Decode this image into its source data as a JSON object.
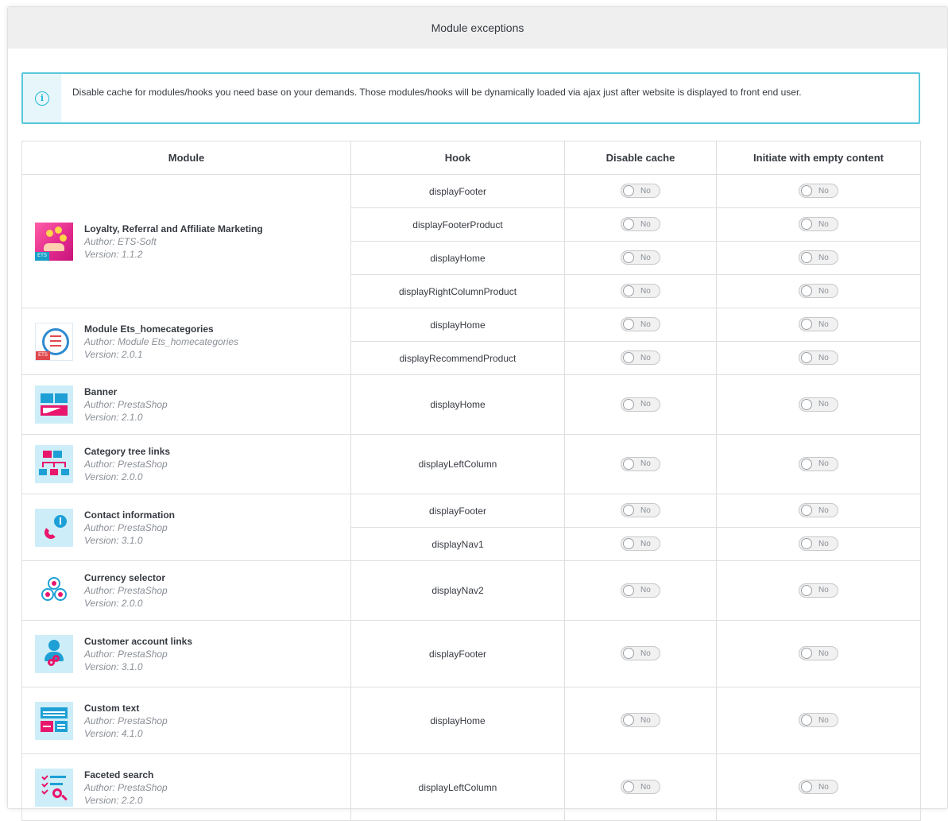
{
  "panel": {
    "title": "Module exceptions"
  },
  "alert": {
    "icon": "info-circle-icon",
    "text": "Disable cache for modules/hooks you need base on your demands. Those modules/hooks will be dynamically loaded via ajax just after website is displayed to front end user."
  },
  "table": {
    "headers": {
      "module": "Module",
      "hook": "Hook",
      "disable_cache": "Disable cache",
      "empty_content": "Initiate with empty content"
    },
    "toggle_label": "No"
  },
  "modules": [
    {
      "name": "Loyalty, Referral and Affiliate Marketing",
      "author": "Author: ETS-Soft",
      "version": "Version: 1.1.2",
      "icon": "loyalty-icon",
      "hooks": [
        "displayFooter",
        "displayFooterProduct",
        "displayHome",
        "displayRightColumnProduct"
      ]
    },
    {
      "name": "Module Ets_homecategories",
      "author": "Author: Module Ets_homecategories",
      "version": "Version: 2.0.1",
      "icon": "home-categories-icon",
      "hooks": [
        "displayHome",
        "displayRecommendProduct"
      ]
    },
    {
      "name": "Banner",
      "author": "Author: PrestaShop",
      "version": "Version: 2.1.0",
      "icon": "banner-icon",
      "hooks": [
        "displayHome"
      ]
    },
    {
      "name": "Category tree links",
      "author": "Author: PrestaShop",
      "version": "Version: 2.0.0",
      "icon": "category-tree-icon",
      "hooks": [
        "displayLeftColumn"
      ]
    },
    {
      "name": "Contact information",
      "author": "Author: PrestaShop",
      "version": "Version: 3.1.0",
      "icon": "contact-info-icon",
      "hooks": [
        "displayFooter",
        "displayNav1"
      ]
    },
    {
      "name": "Currency selector",
      "author": "Author: PrestaShop",
      "version": "Version: 2.0.0",
      "icon": "currency-icon",
      "hooks": [
        "displayNav2"
      ]
    },
    {
      "name": "Customer account links",
      "author": "Author: PrestaShop",
      "version": "Version: 3.1.0",
      "icon": "customer-account-icon",
      "hooks": [
        "displayFooter"
      ]
    },
    {
      "name": "Custom text",
      "author": "Author: PrestaShop",
      "version": "Version: 4.1.0",
      "icon": "custom-text-icon",
      "hooks": [
        "displayHome"
      ]
    },
    {
      "name": "Faceted search",
      "author": "Author: PrestaShop",
      "version": "Version: 2.2.0",
      "icon": "faceted-search-icon",
      "hooks": [
        "displayLeftColumn"
      ]
    }
  ]
}
